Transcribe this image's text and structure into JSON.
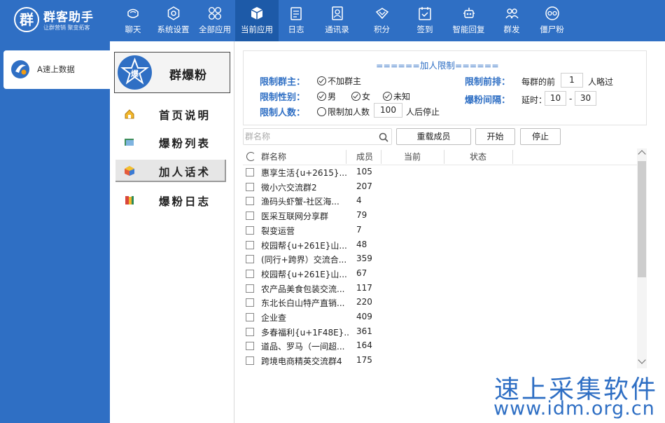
{
  "app": {
    "logo_glyph": "群",
    "title": "群客助手",
    "subtitle": "让群营销 聚变拓客"
  },
  "nav": {
    "items": [
      {
        "label": "聊天",
        "icon": "chat-icon"
      },
      {
        "label": "系统设置",
        "icon": "settings-icon"
      },
      {
        "label": "全部应用",
        "icon": "apps-icon"
      },
      {
        "label": "当前应用",
        "icon": "cube-icon",
        "active": true
      },
      {
        "label": "日志",
        "icon": "log-icon"
      },
      {
        "label": "通讯录",
        "icon": "contacts-icon"
      },
      {
        "label": "积分",
        "icon": "points-icon"
      },
      {
        "label": "签到",
        "icon": "checkin-icon"
      },
      {
        "label": "智能回复",
        "icon": "robot-icon"
      },
      {
        "label": "群发",
        "icon": "group-send-icon"
      },
      {
        "label": "僵尸粉",
        "icon": "zombie-icon"
      }
    ]
  },
  "sidebar": {
    "items": [
      {
        "label": "A速上数据",
        "icon": "app-logo-icon",
        "active": true
      }
    ]
  },
  "app_panel": {
    "badge_text": "爆",
    "title": "群爆粉",
    "menu": [
      {
        "label": "首页说明",
        "icon": "home-icon"
      },
      {
        "label": "爆粉列表",
        "icon": "list-icon"
      },
      {
        "label": "加人话术",
        "icon": "script-icon",
        "active": true
      },
      {
        "label": "爆粉日志",
        "icon": "journal-icon"
      }
    ]
  },
  "limits": {
    "title": "======加人限制======",
    "owner_label": "限制群主：",
    "owner_option": "不加群主",
    "gender_label": "限制性别：",
    "gender_options": [
      "男",
      "女",
      "未知"
    ],
    "count_label": "限制人数：",
    "count_option": "限制加人数",
    "count_value": "100",
    "count_suffix": "人后停止",
    "rank_label": "限制前排：",
    "rank_prefix": "每群的前",
    "rank_value": "1",
    "rank_suffix": "人略过",
    "interval_label": "爆粉间隔：",
    "interval_prefix": "延时：",
    "interval_min": "10",
    "interval_dash": "-",
    "interval_max": "30"
  },
  "toolbar": {
    "search_placeholder": "群名称",
    "reload_label": "重载成员",
    "start_label": "开始",
    "stop_label": "停止"
  },
  "table": {
    "columns": [
      "群名称",
      "成员",
      "当前",
      "状态"
    ],
    "rows": [
      {
        "name": "惠享生活{u+2615}...",
        "members": "105"
      },
      {
        "name": "微小六交流群2",
        "members": "207"
      },
      {
        "name": "渔码头虾蟹-社区海...",
        "members": "4"
      },
      {
        "name": "医采互联网分享群",
        "members": "79"
      },
      {
        "name": "裂变运营",
        "members": "7"
      },
      {
        "name": "校园帮{u+261E}山...",
        "members": "48"
      },
      {
        "name": "(同行+跨界）交流合...",
        "members": "359"
      },
      {
        "name": "校园帮{u+261E}山...",
        "members": "67"
      },
      {
        "name": "农产品美食包装交流...",
        "members": "117"
      },
      {
        "name": "东北长白山特产直销...",
        "members": "220"
      },
      {
        "name": "企业查",
        "members": "409"
      },
      {
        "name": "多春福利{u+1F48E}...",
        "members": "361"
      },
      {
        "name": "道品、罗马（一间超...",
        "members": "164"
      },
      {
        "name": "跨境电商精英交流群4",
        "members": "175"
      }
    ]
  },
  "watermark": {
    "line1": "速上采集软件",
    "line2": "www.idm.org.cn"
  },
  "colors": {
    "accent": "#2f6fc4",
    "accent_dark": "#1d5aa8"
  }
}
